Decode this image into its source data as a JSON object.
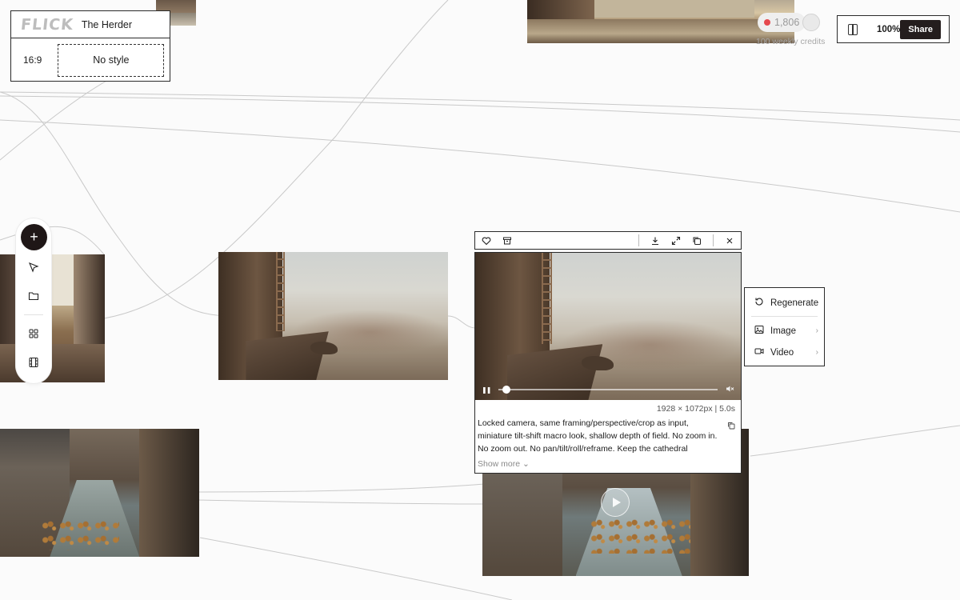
{
  "project": {
    "logo_text": "FLICK",
    "title": "The Herder",
    "aspect_ratio": "16:9",
    "style": "No style"
  },
  "header": {
    "credits_count": "1,806",
    "weekly_credits": "100 weekly credits",
    "zoom": "100%",
    "share_label": "Share"
  },
  "left_toolbar": {
    "items": [
      "plus-icon",
      "cursor-icon",
      "folder-icon",
      "grid-icon",
      "film-icon"
    ]
  },
  "selected_node": {
    "toolbar_icons": [
      "heart-icon",
      "archive-icon",
      "download-icon",
      "expand-icon",
      "duplicate-icon",
      "close-icon"
    ],
    "dimensions": "1928 × 1072px | 5.0s",
    "prompt": "Locked camera, same framing/perspective/crop as input, miniature tilt-shift macro look, shallow depth of field. No zoom in. No zoom out. No pan/tilt/roll/reframe. Keep the cathedral stonework, gargoyles, ladder,...",
    "show_more": "Show more",
    "progress": 0.02
  },
  "context_menu": {
    "items": [
      {
        "label": "Regenerate",
        "icon": "refresh-icon",
        "has_submenu": false
      },
      {
        "label": "Image",
        "icon": "image-icon",
        "has_submenu": true
      },
      {
        "label": "Video",
        "icon": "video-icon",
        "has_submenu": true
      }
    ]
  },
  "colors": {
    "accent_dark": "#241d1d",
    "credit_dot": "#e5484d",
    "canvas_bg": "#fbfbfb"
  }
}
